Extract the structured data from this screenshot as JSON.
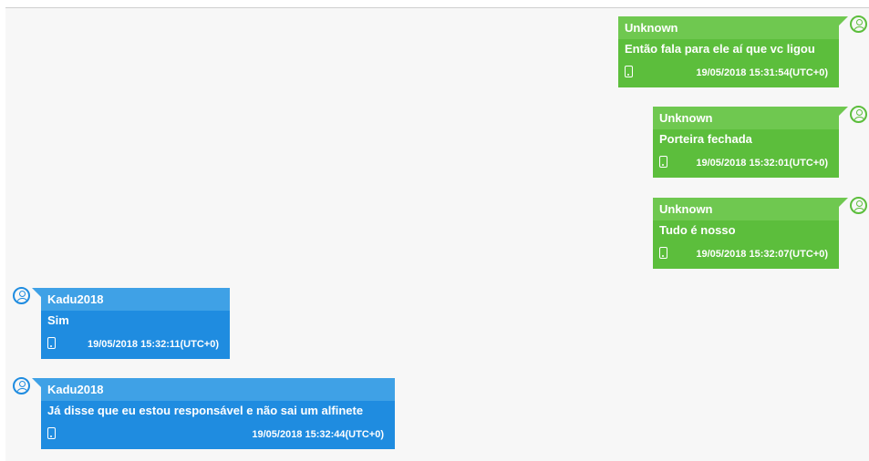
{
  "messages": [
    {
      "sender": "Unknown",
      "text": "Então fala para ele aí que vc ligou",
      "timestamp": "19/05/2018 15:31:54(UTC+0)",
      "direction": "outgoing",
      "color": "#5cbe3c",
      "device_icon": "phone-icon",
      "avatar_icon": "user-avatar-icon"
    },
    {
      "sender": "Unknown",
      "text": "Porteira fechada",
      "timestamp": "19/05/2018 15:32:01(UTC+0)",
      "direction": "outgoing",
      "color": "#5cbe3c",
      "device_icon": "phone-icon",
      "avatar_icon": "user-avatar-icon"
    },
    {
      "sender": "Unknown",
      "text": "Tudo é nosso",
      "timestamp": "19/05/2018 15:32:07(UTC+0)",
      "direction": "outgoing",
      "color": "#5cbe3c",
      "device_icon": "phone-icon",
      "avatar_icon": "user-avatar-icon"
    },
    {
      "sender": "Kadu2018",
      "text": "Sim",
      "timestamp": "19/05/2018 15:32:11(UTC+0)",
      "direction": "incoming",
      "color": "#1f8ce0",
      "device_icon": "phone-icon",
      "avatar_icon": "user-avatar-icon"
    },
    {
      "sender": "Kadu2018",
      "text": "Já disse que eu estou responsável e não sai um alfinete",
      "timestamp": "19/05/2018 15:32:44(UTC+0)",
      "direction": "incoming",
      "color": "#1f8ce0",
      "device_icon": "phone-icon",
      "avatar_icon": "user-avatar-icon"
    }
  ]
}
